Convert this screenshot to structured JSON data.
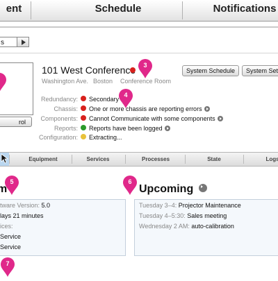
{
  "nav": {
    "tabs": [
      "ent",
      "Schedule",
      "Notifications"
    ]
  },
  "selector": {
    "value": "s"
  },
  "room": {
    "control_label": "rol",
    "title": "101 West Conference",
    "address": "Washington Ave.",
    "city": "Boston",
    "type": "Conference Room",
    "buttons": [
      "System Schedule",
      "System Setti"
    ]
  },
  "status": [
    {
      "label": "Redundancy:",
      "color": "#d8211d",
      "text": "Secondary",
      "arrow": false
    },
    {
      "label": "Chassis:",
      "color": "#d8211d",
      "text": "One or more chassis are reporting errors",
      "arrow": true
    },
    {
      "label": "Components:",
      "color": "#d8211d",
      "text": "Cannot Communicate with some components",
      "arrow": true
    },
    {
      "label": "Reports:",
      "color": "#2a9a2a",
      "text": "Reports have been logged",
      "arrow": true
    },
    {
      "label": "Configuration:",
      "color": "#e8c23a",
      "text": "Extracting...",
      "arrow": false
    }
  ],
  "tabs": [
    "Equipment",
    "Services",
    "Processes",
    "State",
    "Logs"
  ],
  "system": {
    "title": "m",
    "rows": [
      {
        "label": "tware Version:",
        "value": "5.0"
      },
      {
        "label": "",
        "value": "lays 21 minutes"
      },
      {
        "label": "ices:",
        "value": ""
      },
      {
        "label": "",
        "value": "Service"
      },
      {
        "label": "",
        "value": "Service"
      }
    ]
  },
  "upcoming": {
    "title": "Upcoming",
    "events": [
      {
        "when": "Tuesday 3–4:",
        "what": "Projector Maintenance"
      },
      {
        "when": "Tuesday 4–5:30:",
        "what": "Sales meeting"
      },
      {
        "when": "Wednesday 2 AM:",
        "what": "auto-calibration"
      }
    ]
  },
  "markers": [
    "3",
    "4",
    "5",
    "6",
    "7"
  ],
  "colors": {
    "marker": "#e0288a",
    "alert_red": "#d8211d",
    "ok_green": "#2a9a2a",
    "warn_yellow": "#e8c23a",
    "active_tab": "#b9d6ef"
  }
}
